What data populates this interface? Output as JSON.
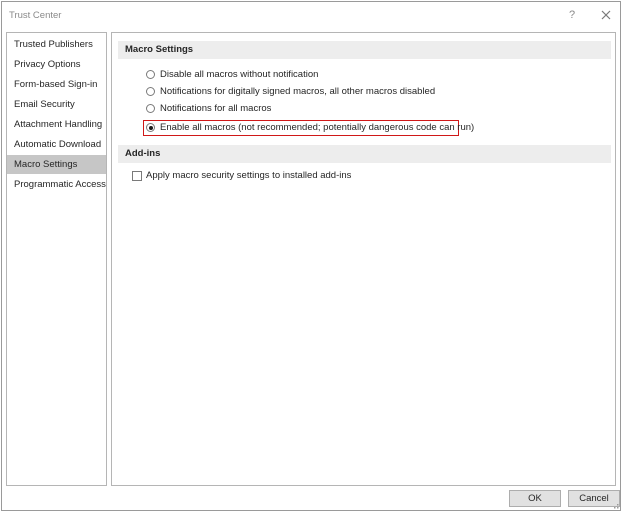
{
  "window": {
    "title": "Trust Center",
    "help_icon": "?"
  },
  "sidebar": {
    "items": [
      {
        "label": "Trusted Publishers",
        "selected": false
      },
      {
        "label": "Privacy Options",
        "selected": false
      },
      {
        "label": "Form-based Sign-in",
        "selected": false
      },
      {
        "label": "Email Security",
        "selected": false
      },
      {
        "label": "Attachment Handling",
        "selected": false
      },
      {
        "label": "Automatic Download",
        "selected": false
      },
      {
        "label": "Macro Settings",
        "selected": true
      },
      {
        "label": "Programmatic Access",
        "selected": false
      }
    ]
  },
  "macro_settings": {
    "header": "Macro Settings",
    "options": [
      {
        "label": "Disable all macros without notification",
        "checked": false
      },
      {
        "label": "Notifications for digitally signed macros, all other macros disabled",
        "checked": false
      },
      {
        "label": "Notifications for all macros",
        "checked": false
      },
      {
        "label": "Enable all macros (not recommended; potentially dangerous code can run)",
        "checked": true
      }
    ],
    "highlight_color": "#d01818"
  },
  "addins": {
    "header": "Add-ins",
    "checkbox_label": "Apply macro security settings to installed add-ins",
    "checked": false
  },
  "footer": {
    "ok_label": "OK",
    "cancel_label": "Cancel"
  },
  "colors": {
    "selected_item_bg": "#c6c6c6",
    "section_header_bg": "#ededed"
  }
}
